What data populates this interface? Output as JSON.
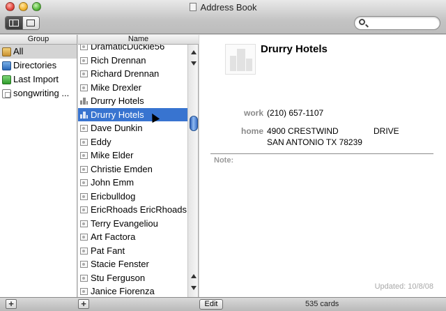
{
  "window": {
    "title": "Address Book"
  },
  "columns": {
    "group": "Group",
    "name": "Name"
  },
  "groups": [
    {
      "label": "All",
      "icon": "all-contacts-icon",
      "selected": true
    },
    {
      "label": "Directories",
      "icon": "directories-icon",
      "selected": false
    },
    {
      "label": "Last Import",
      "icon": "last-import-icon",
      "selected": false
    },
    {
      "label": "songwriting ...",
      "icon": "group-icon",
      "selected": false
    }
  ],
  "names": [
    {
      "label": "DramaticDuckie56",
      "kind": "person"
    },
    {
      "label": "Rich Drennan",
      "kind": "person"
    },
    {
      "label": "Richard Drennan",
      "kind": "person"
    },
    {
      "label": "Mike Drexler",
      "kind": "person"
    },
    {
      "label": "Drurry Hotels",
      "kind": "company"
    },
    {
      "label": "Drurry Hotels",
      "kind": "company",
      "selected": true
    },
    {
      "label": "Dave Dunkin",
      "kind": "person"
    },
    {
      "label": "Eddy",
      "kind": "person"
    },
    {
      "label": "Mike Elder",
      "kind": "person"
    },
    {
      "label": "Christie Emden",
      "kind": "person"
    },
    {
      "label": "John Emm",
      "kind": "person"
    },
    {
      "label": "Ericbulldog",
      "kind": "person"
    },
    {
      "label": "EricRhoads EricRhoads",
      "kind": "person"
    },
    {
      "label": "Terry Evangeliou",
      "kind": "person"
    },
    {
      "label": "Art Factora",
      "kind": "person"
    },
    {
      "label": "Pat Fant",
      "kind": "person"
    },
    {
      "label": "Stacie Fenster",
      "kind": "person"
    },
    {
      "label": "Stu Ferguson",
      "kind": "person"
    },
    {
      "label": "Janice Fiorenza",
      "kind": "person"
    }
  ],
  "card": {
    "name": "Drurry Hotels",
    "phone_label": "work",
    "phone": "(210) 657-1107",
    "address_label": "home",
    "address_line1_a": "4900 CRESTWIND",
    "address_line1_b": "DRIVE",
    "address_line2": "SAN ANTONIO TX 78239",
    "note_label": "Note:",
    "updated": "Updated: 10/8/08"
  },
  "bottom": {
    "add_group": "+",
    "add_card": "+",
    "edit_label": "Edit",
    "count": "535 cards"
  }
}
